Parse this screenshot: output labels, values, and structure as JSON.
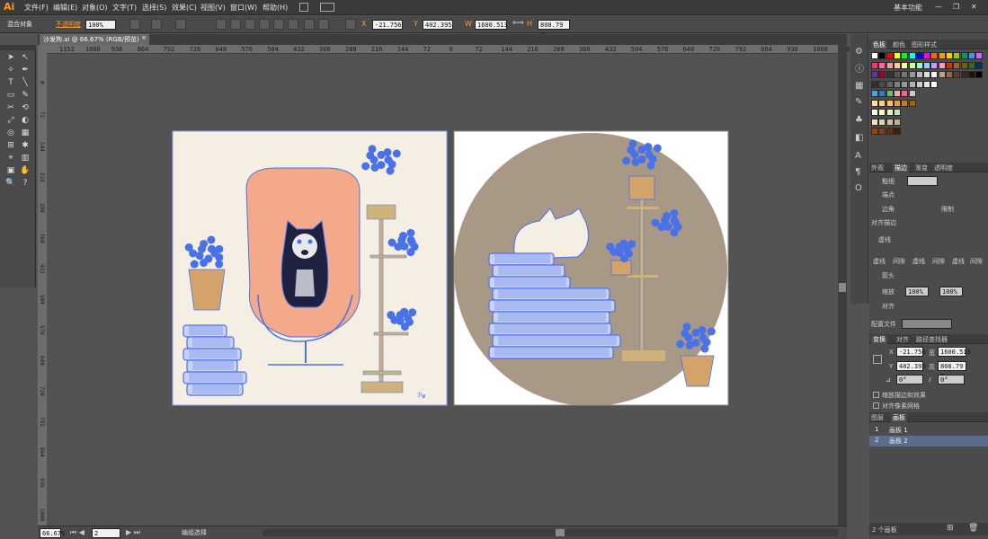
{
  "app": {
    "logo": "Ai",
    "workspace": "基本功能"
  },
  "menu": [
    "文件(F)",
    "编辑(E)",
    "对象(O)",
    "文字(T)",
    "选择(S)",
    "效果(C)",
    "视图(V)",
    "窗口(W)",
    "帮助(H)"
  ],
  "control_bar": {
    "selection_label": "混合对象",
    "opacity_label": "不透明度",
    "opacity_value": "100%",
    "x_value": "-21.756",
    "y_value": "402.395",
    "w_value": "1600.513",
    "h_value": "808.79 p"
  },
  "doc_tab": {
    "title": "沙发狗.ai @ 66.67% (RGB/预览)",
    "close": "×"
  },
  "ruler_h": [
    "1152",
    "1080",
    "936",
    "864",
    "792",
    "720",
    "648",
    "576",
    "504",
    "432",
    "360",
    "288",
    "216",
    "144",
    "72",
    "0",
    "72",
    "144",
    "216",
    "288",
    "360",
    "432",
    "504",
    "576",
    "648",
    "720",
    "792",
    "864",
    "936",
    "1008",
    "1080"
  ],
  "ruler_v": [
    "0",
    "72",
    "144",
    "216",
    "288",
    "360",
    "432",
    "504",
    "576",
    "648",
    "720",
    "792",
    "864",
    "936",
    "1008"
  ],
  "status": {
    "zoom": "66.67%",
    "artboard": "2",
    "mode": "编组选择"
  },
  "swatches_panel": {
    "tabs": [
      "色板",
      "颜色",
      "图形样式"
    ],
    "rows": [
      [
        "#ffffff",
        "#000000",
        "#ff0000",
        "#ffff00",
        "#00ff00",
        "#00ffff",
        "#0000ff",
        "#ff00ff",
        "#ff6600",
        "#ff9900",
        "#ffcc00",
        "#99cc00",
        "#009966",
        "#3399ff",
        "#cc66ff"
      ],
      [
        "#ff3366",
        "#ff6699",
        "#ff9999",
        "#ffcc99",
        "#ffff99",
        "#ccff99",
        "#99ffcc",
        "#99ccff",
        "#cc99ff",
        "#ff99cc",
        "#cc3300",
        "#996633",
        "#666600",
        "#336633",
        "#003366"
      ],
      [
        "#663399",
        "#990033",
        "#333333",
        "#555555",
        "#777777",
        "#999999",
        "#bbbbbb",
        "#dddddd",
        "#f2f2f2",
        "#c0a080",
        "#8c6e4a",
        "#5a4030",
        "#3a2a1a",
        "#20140a",
        "#000000"
      ],
      [
        "#303030",
        "#4a4a4a",
        "#646464",
        "#7e7e7e",
        "#989898",
        "#b2b2b2",
        "#cccccc",
        "#e6e6e6",
        "#ffffff"
      ],
      [
        "#4aa3df",
        "#2e7bbf",
        "#5fbf6a",
        "#ffa0c0",
        "#ff6080",
        "#cccccc"
      ],
      [
        "#ffe0a0",
        "#ffd080",
        "#ffc060",
        "#e0a040",
        "#c08020",
        "#a06010"
      ],
      [
        "#ffffe0",
        "#ffffc0",
        "#e0f0c0",
        "#c0e0c0"
      ],
      [
        "#f0e0c0",
        "#e0d0b0",
        "#d0c0a0",
        "#c0b090"
      ],
      [
        "#a04000",
        "#804020",
        "#603010",
        "#402000"
      ]
    ]
  },
  "stroke_panel": {
    "tabs": [
      "外观",
      "描边",
      "渐变",
      "透明度"
    ],
    "weight_label": "粗细",
    "cap_label": "端点",
    "corner_label": "边角",
    "limit_label": "限制",
    "align_label": "对齐描边",
    "dashed_label": "虚线",
    "dash_labels": [
      "虚线",
      "间隙",
      "虚线",
      "间隙",
      "虚线",
      "间隙"
    ],
    "arrow_label": "箭头",
    "scale_label": "缩放",
    "scale_a": "100%",
    "scale_b": "100%",
    "align_label2": "对齐",
    "profile_label": "配置文件"
  },
  "transform_panel": {
    "tabs": [
      "变换",
      "对齐",
      "路径查找器"
    ],
    "x_label": "X",
    "x_value": "-21.756",
    "w_label": "宽",
    "w_value": "1600.513",
    "y_label": "Y",
    "y_value": "402.395",
    "h_label": "高",
    "h_value": "808.79 p",
    "rotate_value": "0°",
    "shear_value": "0°",
    "opt1": "缩放描边和效果",
    "opt2": "对齐像素网格"
  },
  "layers_panel": {
    "tabs": [
      "图层",
      "画板"
    ],
    "items": [
      {
        "num": "1",
        "name": "画板 1"
      },
      {
        "num": "2",
        "name": "画板 2"
      }
    ],
    "footer": "2 个画板"
  },
  "colors": {
    "artboard1_bg": "#f5efe3",
    "chair": "#f4a98a",
    "selection": "#4a72e8",
    "pot": "#d4a36a",
    "shelf": "#cdb27a",
    "circle": "#a89886",
    "dog_dark": "#1e2240"
  }
}
